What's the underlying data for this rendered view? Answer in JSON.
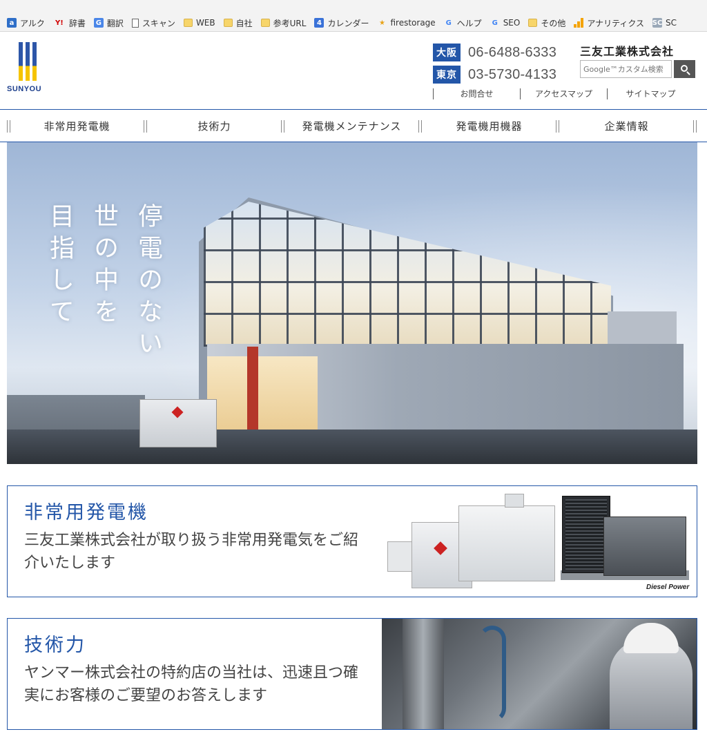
{
  "bookmarks": [
    {
      "label": "アルク",
      "icon": "alc-icon"
    },
    {
      "label": "辞書",
      "icon": "yahoo-icon"
    },
    {
      "label": "翻訳",
      "icon": "translate-icon"
    },
    {
      "label": "スキャン",
      "icon": "document-icon"
    },
    {
      "label": "WEB",
      "icon": "folder-icon"
    },
    {
      "label": "自社",
      "icon": "folder-icon"
    },
    {
      "label": "参考URL",
      "icon": "folder-icon"
    },
    {
      "label": "カレンダー",
      "icon": "calendar-icon"
    },
    {
      "label": "firestorage",
      "icon": "star-icon"
    },
    {
      "label": "ヘルプ",
      "icon": "google-icon"
    },
    {
      "label": "SEO",
      "icon": "google-icon"
    },
    {
      "label": "その他",
      "icon": "folder-icon"
    },
    {
      "label": "アナリティクス",
      "icon": "analytics-icon"
    },
    {
      "label": "SC",
      "icon": "search-console-icon"
    }
  ],
  "bookmark_icon_text": {
    "alc": "a",
    "yahoo": "Y!",
    "translate": "G",
    "calendar": "4",
    "star": "★",
    "google": "G",
    "sc": "SC"
  },
  "header": {
    "logo_text": "SUNYOU",
    "company_name": "三友工業株式会社",
    "phones": [
      {
        "city": "大阪",
        "number": "06-6488-6333"
      },
      {
        "city": "東京",
        "number": "03-5730-4133"
      }
    ],
    "search": {
      "placeholder": "Google™カスタム検索"
    },
    "utility_links": [
      "お問合せ",
      "アクセスマップ",
      "サイトマップ"
    ]
  },
  "nav": {
    "items": [
      "非常用発電機",
      "技術力",
      "発電機メンテナンス",
      "発電機用機器",
      "企業情報"
    ]
  },
  "hero": {
    "copy_lines": [
      "停電のない",
      "世の中を",
      "目指して"
    ]
  },
  "sections": [
    {
      "title": "非常用発電機",
      "description": "三友工業株式会社が取り扱う非常用発電気をご紹介いたします",
      "image_caption": "Diesel Power"
    },
    {
      "title": "技術力",
      "description": "ヤンマー株式会社の特約店の当社は、迅速且つ確実にお客様のご要望のお答えします"
    }
  ],
  "colors": {
    "brand_blue": "#2356a8",
    "brand_yellow": "#f5c400",
    "nav_border": "#2356a8"
  }
}
